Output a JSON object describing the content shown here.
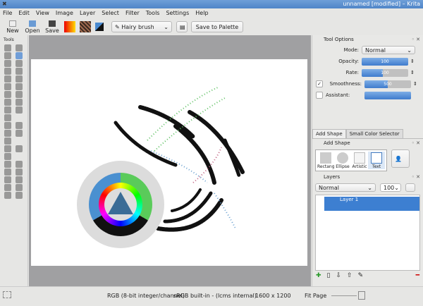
{
  "window": {
    "title": "unnamed [modified] – Krita",
    "close": "✖"
  },
  "menu": [
    "File",
    "Edit",
    "View",
    "Image",
    "Layer",
    "Select",
    "Filter",
    "Tools",
    "Settings",
    "Help"
  ],
  "toolbar": {
    "new": "New",
    "open": "Open",
    "save": "Save",
    "brush_preset": "Hairy brush",
    "save_palette": "Save to Palette"
  },
  "toolbox": {
    "title": "Tools"
  },
  "tool_options": {
    "title": "Tool Options",
    "mode_label": "Mode:",
    "mode_value": "Normal",
    "opacity_label": "Opacity:",
    "opacity_value": "100",
    "opacity_fraction": 1.0,
    "rate_label": "Rate:",
    "rate_value": "100",
    "rate_fraction": 0.45,
    "smoothness_label": "Smoothness:",
    "smoothness_value": "500",
    "smoothness_fraction": 0.5,
    "smoothness_checked": true,
    "assistant_label": "Assistant:",
    "assistant_checked": false
  },
  "tabs": [
    "Add Shape",
    "Small Color Selector"
  ],
  "add_shape": {
    "title": "Add Shape",
    "shapes": [
      "Rectangle",
      "Ellipse",
      "Artistic",
      "Text"
    ]
  },
  "layers": {
    "title": "Layers",
    "blend": "Normal",
    "opacity": "100",
    "items": [
      {
        "name": "Layer 1"
      }
    ]
  },
  "status": {
    "color_model": "RGB (8-bit integer/channel)",
    "profile": "sRGB built-in - (lcms internal)",
    "size": "1600 x 1200",
    "zoom": "Fit Page"
  }
}
